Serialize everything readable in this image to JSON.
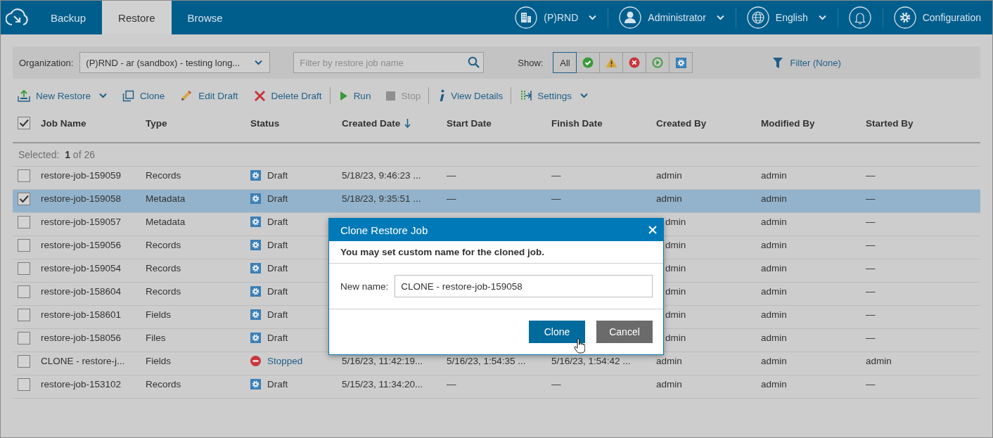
{
  "header": {
    "tabs": [
      {
        "label": "Backup",
        "selected": false
      },
      {
        "label": "Restore",
        "selected": true
      },
      {
        "label": "Browse",
        "selected": false
      }
    ],
    "menus": [
      {
        "kind": "org",
        "label": "(P)RND",
        "dropdown": true
      },
      {
        "kind": "user",
        "label": "Administrator",
        "dropdown": true
      },
      {
        "kind": "language",
        "label": "English",
        "dropdown": true
      },
      {
        "kind": "notifications"
      },
      {
        "kind": "settings",
        "label": "Configuration"
      }
    ]
  },
  "filter_bar": {
    "organization_label": "Organization:",
    "organization_value": "(P)RND - ar (sandbox) - testing long...",
    "search_placeholder": "Filter by restore job name",
    "show_label": "Show:",
    "show_filters": [
      {
        "kind": "all",
        "label": "All",
        "selected": true
      },
      {
        "kind": "success",
        "selected": false
      },
      {
        "kind": "warning",
        "selected": false
      },
      {
        "kind": "failed",
        "selected": false
      },
      {
        "kind": "running",
        "selected": false
      },
      {
        "kind": "draft",
        "selected": false
      }
    ],
    "filter_link": "Filter (None)"
  },
  "toolbar": [
    {
      "kind": "new",
      "label": "New Restore",
      "dropdown": true,
      "disabled": false
    },
    {
      "kind": "clone",
      "label": "Clone",
      "disabled": false
    },
    {
      "kind": "edit",
      "label": "Edit Draft",
      "disabled": false
    },
    {
      "kind": "delete",
      "label": "Delete Draft",
      "disabled": false
    },
    {
      "kind": "separator"
    },
    {
      "kind": "run",
      "label": "Run",
      "disabled": false
    },
    {
      "kind": "stop",
      "label": "Stop",
      "disabled": true
    },
    {
      "kind": "separator"
    },
    {
      "kind": "details",
      "label": "View Details",
      "disabled": false
    },
    {
      "kind": "separator"
    },
    {
      "kind": "settings",
      "label": "Settings",
      "dropdown": true,
      "disabled": false
    }
  ],
  "table": {
    "select_all_checked": true,
    "columns": [
      {
        "label": "Job Name",
        "sorted": false
      },
      {
        "label": "Type",
        "sorted": false
      },
      {
        "label": "Status",
        "sorted": false
      },
      {
        "label": "Created Date",
        "sorted": true
      },
      {
        "label": "Start Date",
        "sorted": false
      },
      {
        "label": "Finish Date",
        "sorted": false
      },
      {
        "label": "Created By",
        "sorted": false
      },
      {
        "label": "Modified By",
        "sorted": false
      },
      {
        "label": "Started By",
        "sorted": false
      }
    ],
    "selection_summary": "Selected:  **1** of 26",
    "rows": [
      {
        "checked": false,
        "selected": false,
        "job_name": "restore-job-159059",
        "type": "Records",
        "status": {
          "kind": "draft",
          "label": "Draft"
        },
        "created_date": "5/18/23, 9:46:23 ...",
        "start_date": "—",
        "finish_date": "—",
        "created_by": "admin",
        "modified_by": "admin",
        "started_by": "—"
      },
      {
        "checked": true,
        "selected": true,
        "job_name": "restore-job-159058",
        "type": "Metadata",
        "status": {
          "kind": "draft",
          "label": "Draft"
        },
        "created_date": "5/18/23, 9:35:51 ...",
        "start_date": "—",
        "finish_date": "—",
        "created_by": "admin",
        "modified_by": "admin",
        "started_by": "—"
      },
      {
        "checked": false,
        "selected": false,
        "job_name": "restore-job-159057",
        "type": "Metadata",
        "status": {
          "kind": "draft",
          "label": "Draft"
        },
        "created_by": "dmin",
        "modified_by": "admin",
        "started_by": "—"
      },
      {
        "checked": false,
        "selected": false,
        "job_name": "restore-job-159056",
        "type": "Records",
        "status": {
          "kind": "draft",
          "label": "Draft"
        },
        "created_by": "dmin",
        "modified_by": "admin",
        "started_by": "—"
      },
      {
        "checked": false,
        "selected": false,
        "job_name": "restore-job-159054",
        "type": "Records",
        "status": {
          "kind": "draft",
          "label": "Draft"
        },
        "created_by": "dmin",
        "modified_by": "admin",
        "started_by": "—"
      },
      {
        "checked": false,
        "selected": false,
        "job_name": "restore-job-158604",
        "type": "Records",
        "status": {
          "kind": "draft",
          "label": "Draft"
        },
        "created_by": "dmin",
        "modified_by": "admin",
        "started_by": "—"
      },
      {
        "checked": false,
        "selected": false,
        "job_name": "restore-job-158601",
        "type": "Fields",
        "status": {
          "kind": "draft",
          "label": "Draft"
        },
        "created_by": "dmin",
        "modified_by": "admin",
        "started_by": "—"
      },
      {
        "checked": false,
        "selected": false,
        "job_name": "restore-job-158056",
        "type": "Files",
        "status": {
          "kind": "draft",
          "label": "Draft"
        },
        "created_by": "dmin",
        "modified_by": "admin",
        "started_by": "—"
      },
      {
        "checked": false,
        "selected": false,
        "job_name": "CLONE - restore-j...",
        "type": "Fields",
        "status": {
          "kind": "stopped",
          "label": "Stopped"
        },
        "created_date": "5/16/23, 11:42:19...",
        "start_date": "5/16/23, 1:54:35 ...",
        "finish_date": "5/16/23, 1:54:42 ...",
        "created_by": "admin",
        "modified_by": "admin",
        "started_by": "admin"
      },
      {
        "checked": false,
        "selected": false,
        "job_name": "restore-job-153102",
        "type": "Records",
        "status": {
          "kind": "draft",
          "label": "Draft"
        },
        "created_date": "5/15/23, 11:34:20...",
        "start_date": "—",
        "finish_date": "—",
        "created_by": "admin",
        "modified_by": "admin",
        "started_by": "—"
      }
    ]
  },
  "dialog": {
    "title": "Clone Restore Job",
    "message": "You may set custom name for the cloned job.",
    "field_label": "New name:",
    "field_value": "CLONE - restore-job-159058",
    "buttons": [
      {
        "kind": "primary",
        "label": "Clone"
      },
      {
        "kind": "secondary",
        "label": "Cancel"
      }
    ]
  }
}
